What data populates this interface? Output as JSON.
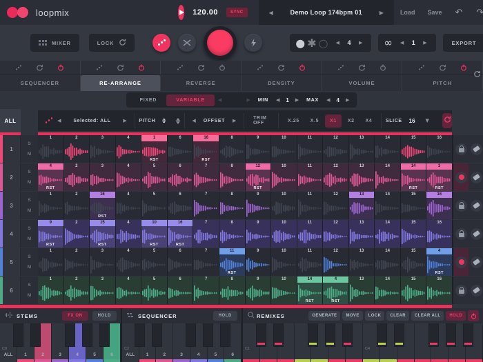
{
  "header": {
    "logo_text": "loopmix",
    "bpm": "120.00",
    "sync_label": "SYNC",
    "preset_name": "Demo Loop 174bpm 01",
    "load_label": "Load",
    "save_label": "Save"
  },
  "transport": {
    "mixer_label": "MIXER",
    "lock_label": "LOCK",
    "pattern_value": "4",
    "loop_value": "1",
    "export_label": "EXPORT"
  },
  "tabs": {
    "items": [
      {
        "label": "SEQUENCER",
        "active": false,
        "power": true
      },
      {
        "label": "RE-ARRANGE",
        "active": true,
        "power": true
      },
      {
        "label": "REVERSE",
        "active": false,
        "power": false
      },
      {
        "label": "DENSITY",
        "active": false,
        "power": true
      },
      {
        "label": "VOLUME",
        "active": false,
        "power": false
      },
      {
        "label": "PITCH",
        "active": false,
        "power": true
      }
    ]
  },
  "variation": {
    "fixed_label": "FIXED",
    "variable_label": "VARIABLE",
    "min_label": "MIN",
    "min_value": "1",
    "max_label": "MAX",
    "max_value": "4"
  },
  "toolbar": {
    "selected_label": "Selected: ALL",
    "pitch_label": "PITCH",
    "pitch_value": "0",
    "offset_label": "OFFSET",
    "trim_label": "TRIM OFF",
    "speeds": [
      "X.25",
      "X.5",
      "X1",
      "X2",
      "X4"
    ],
    "speed_active": "X1",
    "slice_label": "SLICE",
    "slice_value": "16"
  },
  "grid": {
    "all_label": "ALL",
    "solo_label": "S",
    "mute_label": "M",
    "rst_label": "RST",
    "gray_wave": "#3e434f",
    "tracks": [
      {
        "num": "1",
        "color": "#ef4778",
        "hl": "#f56d99",
        "hbg": "#43283a",
        "bg": "#282b33",
        "locked": false,
        "slices": [
          {
            "n": "1"
          },
          {
            "n": "2",
            "c": 1
          },
          {
            "n": "3"
          },
          {
            "n": "4",
            "c": 1
          },
          {
            "n": "1",
            "c": 1,
            "h": 1,
            "r": 1
          },
          {
            "n": "6"
          },
          {
            "n": "16",
            "h": 1,
            "r": 1
          },
          {
            "n": "8"
          },
          {
            "n": "9"
          },
          {
            "n": "10"
          },
          {
            "n": "11"
          },
          {
            "n": "12"
          },
          {
            "n": "13"
          },
          {
            "n": "14"
          },
          {
            "n": "15",
            "c": 1
          },
          {
            "n": "16"
          }
        ]
      },
      {
        "num": "2",
        "color": "#dd5795",
        "hl": "#ef6ba8",
        "hbg": "#5a3350",
        "bg": "#402a3e",
        "locked": true,
        "all_colored": true,
        "slices": [
          {
            "n": "4",
            "h": 1,
            "r": 1
          },
          {
            "n": "2"
          },
          {
            "n": "3"
          },
          {
            "n": "4"
          },
          {
            "n": "5"
          },
          {
            "n": "6"
          },
          {
            "n": "7"
          },
          {
            "n": "8"
          },
          {
            "n": "12",
            "h": 1,
            "r": 1
          },
          {
            "n": "10"
          },
          {
            "n": "11"
          },
          {
            "n": "12"
          },
          {
            "n": "13"
          },
          {
            "n": "14"
          },
          {
            "n": "14",
            "h": 1,
            "r": 1
          },
          {
            "n": "3",
            "h": 1,
            "r": 1
          }
        ]
      },
      {
        "num": "3",
        "color": "#9d63cf",
        "hl": "#b37fe0",
        "hbg": "#3c2f50",
        "bg": "#282b33",
        "locked": false,
        "slices": [
          {
            "n": "1"
          },
          {
            "n": "2"
          },
          {
            "n": "16",
            "h": 1,
            "r": 1
          },
          {
            "n": "4"
          },
          {
            "n": "5"
          },
          {
            "n": "6"
          },
          {
            "n": "7",
            "c": 1
          },
          {
            "n": "8",
            "c": 1
          },
          {
            "n": "9",
            "c": 1
          },
          {
            "n": "10"
          },
          {
            "n": "11"
          },
          {
            "n": "12"
          },
          {
            "n": "13",
            "c": 1,
            "h": 1
          },
          {
            "n": "14"
          },
          {
            "n": "15"
          },
          {
            "n": "16",
            "c": 1,
            "h": 1
          }
        ]
      },
      {
        "num": "4",
        "color": "#8277de",
        "hl": "#978ceb",
        "hbg": "#4a4276",
        "bg": "#37315c",
        "locked": false,
        "all_colored": true,
        "slices": [
          {
            "n": "9",
            "h": 1,
            "r": 1
          },
          {
            "n": "2"
          },
          {
            "n": "15",
            "h": 1,
            "r": 1
          },
          {
            "n": "4"
          },
          {
            "n": "10",
            "h": 1,
            "r": 1
          },
          {
            "n": "16",
            "h": 1,
            "r": 1
          },
          {
            "n": "7"
          },
          {
            "n": "8"
          },
          {
            "n": "9"
          },
          {
            "n": "10"
          },
          {
            "n": "11"
          },
          {
            "n": "12"
          },
          {
            "n": "13"
          },
          {
            "n": "14"
          },
          {
            "n": "15"
          },
          {
            "n": "16"
          }
        ]
      },
      {
        "num": "5",
        "color": "#5181d8",
        "hl": "#6f9fe8",
        "hbg": "#2c3a5c",
        "bg": "#282b33",
        "locked": true,
        "slices": [
          {
            "n": "1"
          },
          {
            "n": "2"
          },
          {
            "n": "3"
          },
          {
            "n": "4"
          },
          {
            "n": "5"
          },
          {
            "n": "6"
          },
          {
            "n": "7"
          },
          {
            "n": "11",
            "c": 1,
            "h": 1,
            "r": 1
          },
          {
            "n": "9",
            "c": 1
          },
          {
            "n": "10"
          },
          {
            "n": "11"
          },
          {
            "n": "12",
            "c": 1
          },
          {
            "n": "13"
          },
          {
            "n": "14"
          },
          {
            "n": "15"
          },
          {
            "n": "4",
            "c": 1,
            "h": 1,
            "r": 1
          }
        ]
      },
      {
        "num": "6",
        "color": "#4dac86",
        "hl": "#6cc7a0",
        "hbg": "#2e4f43",
        "bg": "#2a3d35",
        "locked": false,
        "all_colored": true,
        "slices": [
          {
            "n": "1"
          },
          {
            "n": "2"
          },
          {
            "n": "3"
          },
          {
            "n": "4"
          },
          {
            "n": "5"
          },
          {
            "n": "6"
          },
          {
            "n": "7"
          },
          {
            "n": "8"
          },
          {
            "n": "9"
          },
          {
            "n": "10"
          },
          {
            "n": "14",
            "h": 1,
            "r": 1
          },
          {
            "n": "4",
            "h": 1,
            "r": 1
          },
          {
            "n": "13"
          },
          {
            "n": "14"
          },
          {
            "n": "15"
          },
          {
            "n": "16"
          }
        ]
      }
    ]
  },
  "bottom": {
    "stems": {
      "title": "STEMS",
      "fx_label": "FX ON",
      "hold_label": "HOLD",
      "octave": "C0",
      "all_label": "ALL",
      "key_labels": [
        "1",
        "2",
        "3",
        "4",
        "5",
        "6"
      ],
      "pressed": {
        "2": "#bf4a70",
        "4": "#6a63c6",
        "6": "#44a47f"
      }
    },
    "sequencer": {
      "title": "SEQUENCER",
      "hold_label": "HOLD",
      "octave": "C2",
      "all_label": "ALL",
      "key_labels": [
        "1",
        "2",
        "3",
        "4",
        "5",
        "6"
      ]
    },
    "remixes": {
      "title": "REMIXES",
      "buttons": [
        "GENERATE",
        "MOVE",
        "LOCK",
        "CLEAR",
        "CLEAR ALL"
      ],
      "hold_label": "HOLD",
      "white_stripes": [
        "p",
        "p",
        "p",
        "l",
        "l",
        "p",
        "p",
        "l",
        "l",
        "p",
        "p",
        "p",
        "p",
        "p"
      ],
      "white_labels": {
        "0": "C1",
        "7": "C4"
      },
      "black_after": [
        0,
        1,
        3,
        4,
        5,
        7,
        8,
        10,
        11,
        12
      ],
      "black_stripes": [
        "p",
        "p",
        "l",
        "l",
        "p",
        "l",
        "l",
        "p",
        "p",
        "p"
      ]
    }
  },
  "colors": {
    "accent": "#ee3a62",
    "lime": "#bdd04e",
    "track_colors": [
      "#ef4778",
      "#dd5795",
      "#9d63cf",
      "#8277de",
      "#5181d8",
      "#4dac86"
    ]
  }
}
